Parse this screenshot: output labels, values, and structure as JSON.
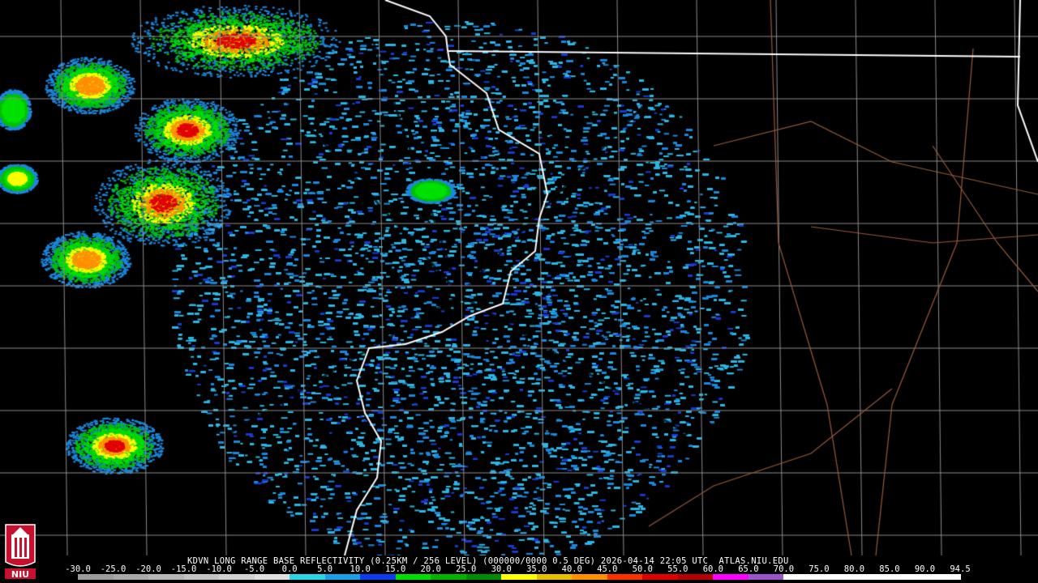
{
  "product_line": "KDVN LONG RANGE BASE REFLECTIVITY (0.25KM / 256 LEVEL) (000000/0000 0.5 DEG) 2026-04-14 22:05 UTC  ATLAS.NIU.EDU",
  "logo_text": "NIU",
  "scale": {
    "labels": [
      "-30.0",
      "-25.0",
      "-20.0",
      "-15.0",
      "-10.0",
      "-5.0",
      "0.0",
      "5.0",
      "10.0",
      "15.0",
      "20.0",
      "25.0",
      "30.0",
      "35.0",
      "40.0",
      "45.0",
      "50.0",
      "55.0",
      "60.0",
      "65.0",
      "70.0",
      "75.0",
      "80.0",
      "85.0",
      "90.0",
      "94.5"
    ],
    "colors": [
      "#9c9c9c",
      "#a8a8a8",
      "#b6b6b6",
      "#c4c4c4",
      "#d2d2d2",
      "#e0e0e0",
      "#2bd5e6",
      "#1aa0e6",
      "#0a3cf0",
      "#00e000",
      "#00b400",
      "#008c00",
      "#ffff00",
      "#e6c000",
      "#ff9000",
      "#ff3000",
      "#e00000",
      "#b40000",
      "#ff00ff",
      "#9a55c9",
      "#ffffff",
      "#ffffff",
      "#ffffff",
      "#ffffff",
      "#ffffff"
    ]
  },
  "colors": {
    "state_border": "#ffffff",
    "county_line": "#8c8c8c",
    "highway": "#9a5a3a",
    "radar_site": "#000000",
    "logo_red": "#c8102e"
  },
  "radar_site": "KDVN"
}
